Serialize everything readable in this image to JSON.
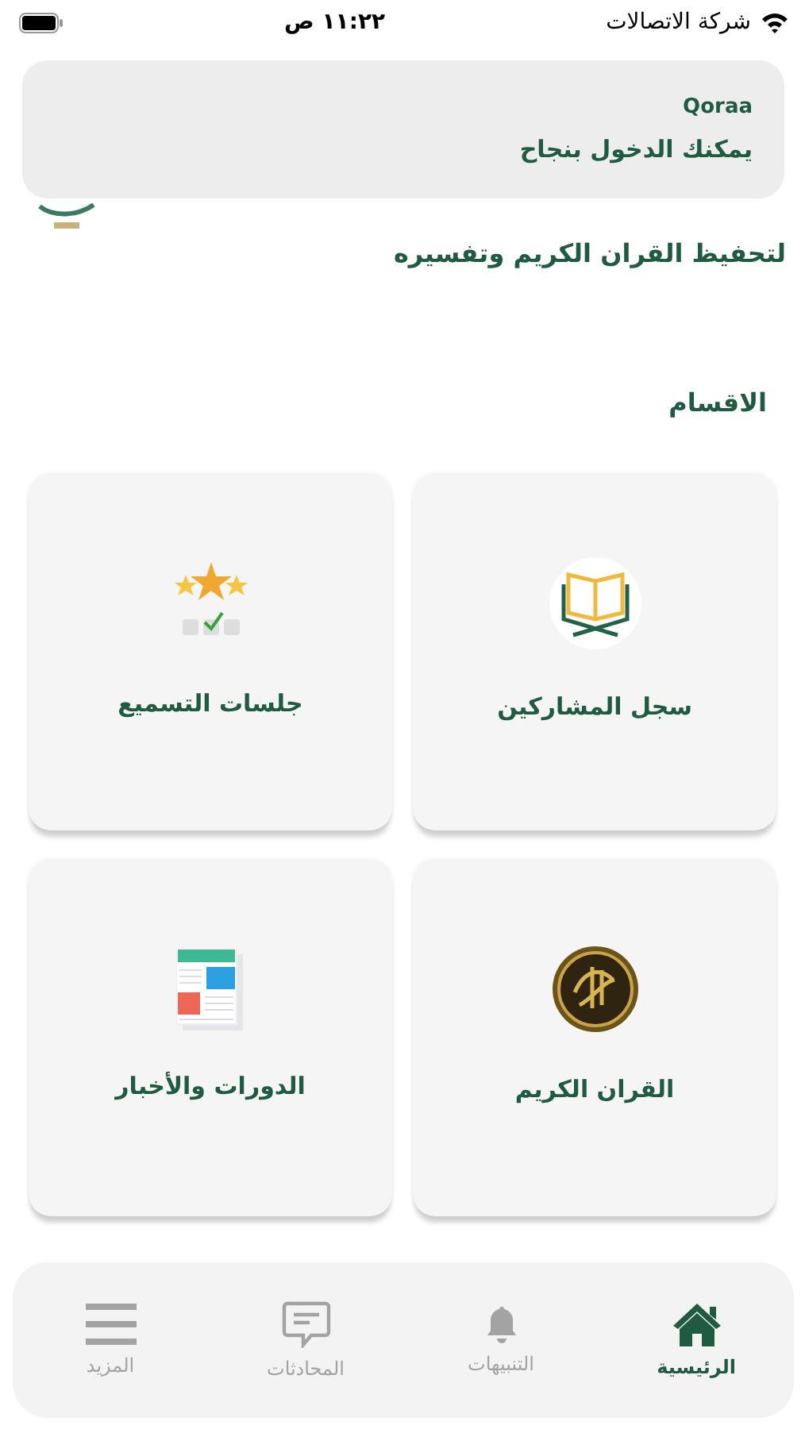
{
  "status_bar": {
    "carrier": "شركة الاتصالات",
    "time": "١١:٢٢ ص"
  },
  "notification": {
    "app": "Qoraa",
    "message": "يمكنك الدخول بنجاح"
  },
  "welcome": {
    "line": "لتحفيظ القران الكريم وتفسيره"
  },
  "sections_title": "الاقسام",
  "sections": [
    {
      "label": "سجل المشاركين",
      "kind": "book-stand"
    },
    {
      "label": "جلسات التسميع",
      "kind": "stars"
    },
    {
      "label": "القران الكريم",
      "kind": "medallion"
    },
    {
      "label": "الدورات والأخبار",
      "kind": "newspaper"
    }
  ],
  "tab_bar": [
    {
      "label": "الرئيسية",
      "kind": "home",
      "selected": true
    },
    {
      "label": "التنبيهات",
      "kind": "bell",
      "selected": false
    },
    {
      "label": "المحادثات",
      "kind": "chat",
      "selected": false
    },
    {
      "label": "المزيد",
      "kind": "menu",
      "selected": false
    }
  ]
}
